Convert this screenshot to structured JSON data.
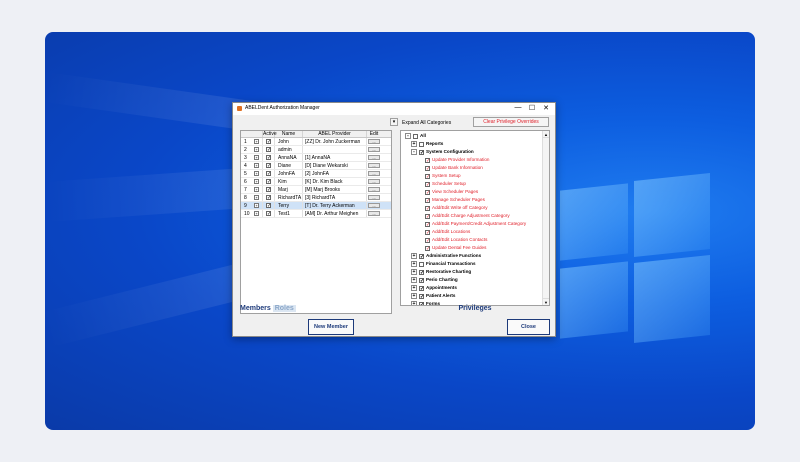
{
  "window": {
    "title": "ABELDent Authorization Manager",
    "controls": {
      "minimize": "—",
      "maximize": "☐",
      "close": "✕"
    }
  },
  "toolbar": {
    "dropdown_arrow": "▾",
    "expand_all_label": "Expand All Categories",
    "clear_overrides_label": "Clear Privilege Overrides"
  },
  "members": {
    "columns": [
      "",
      "Active",
      "Name",
      "ABEL Provider",
      "Edit"
    ],
    "rows": [
      {
        "num": "1",
        "active": "✓",
        "name": "John",
        "provider": "[ZZ] Dr. John Zuckerman",
        "selected": false
      },
      {
        "num": "2",
        "active": "✓",
        "name": "admin",
        "provider": "",
        "selected": false
      },
      {
        "num": "3",
        "active": "✓",
        "name": "AnnaNA",
        "provider": "[1] AnnaNA",
        "selected": false
      },
      {
        "num": "4",
        "active": "✓",
        "name": "Diane",
        "provider": "[D] Diane Wekarski",
        "selected": false
      },
      {
        "num": "5",
        "active": "✓",
        "name": "JohnFA",
        "provider": "[2] JohnFA",
        "selected": false
      },
      {
        "num": "6",
        "active": "✓",
        "name": "Kim",
        "provider": "[K] Dr. Kim Black",
        "selected": false
      },
      {
        "num": "7",
        "active": "✓",
        "name": "Marj",
        "provider": "[M] Marj Brooks",
        "selected": false
      },
      {
        "num": "8",
        "active": "✓",
        "name": "RichardTA",
        "provider": "[3] RichardTA",
        "selected": false
      },
      {
        "num": "9",
        "active": "✓",
        "name": "Terry",
        "provider": "[T] Dr. Terry Ackerman",
        "selected": true
      },
      {
        "num": "10",
        "active": "✓",
        "name": "Test1",
        "provider": "[AM] Dr. Arthur Meighen",
        "selected": false
      }
    ],
    "edit_button_label": "...",
    "tab_members": "Members",
    "tab_roles": "Roles"
  },
  "privileges": {
    "title": "Privileges",
    "nodes": [
      {
        "label": "All",
        "level": 0,
        "pm": "-",
        "checked": false,
        "style": "bold"
      },
      {
        "label": "Reports",
        "level": 1,
        "pm": "+",
        "checked": false,
        "style": "bold"
      },
      {
        "label": "System Configuration",
        "level": 1,
        "pm": "-",
        "checked": true,
        "style": "bold"
      },
      {
        "label": "Update Provider Information",
        "level": 2,
        "pm": "",
        "checked": true,
        "style": "red"
      },
      {
        "label": "Update Bank Information",
        "level": 2,
        "pm": "",
        "checked": true,
        "style": "red"
      },
      {
        "label": "System Setup",
        "level": 2,
        "pm": "",
        "checked": true,
        "style": "red"
      },
      {
        "label": "Scheduler Setup",
        "level": 2,
        "pm": "",
        "checked": true,
        "style": "red"
      },
      {
        "label": "View Scheduler Pages",
        "level": 2,
        "pm": "",
        "checked": true,
        "style": "red"
      },
      {
        "label": "Manage Scheduler Pages",
        "level": 2,
        "pm": "",
        "checked": true,
        "style": "red"
      },
      {
        "label": "Add/Edit Write off Category",
        "level": 2,
        "pm": "",
        "checked": true,
        "style": "red"
      },
      {
        "label": "Add/Edit Charge Adjustment Category",
        "level": 2,
        "pm": "",
        "checked": true,
        "style": "red"
      },
      {
        "label": "Add/Edit Payment/Credit Adjustment Category",
        "level": 2,
        "pm": "",
        "checked": true,
        "style": "red"
      },
      {
        "label": "Add/Edit Locations",
        "level": 2,
        "pm": "",
        "checked": true,
        "style": "red"
      },
      {
        "label": "Add/Edit Location Contacts",
        "level": 2,
        "pm": "",
        "checked": true,
        "style": "red"
      },
      {
        "label": "Update Dental Fee Guides",
        "level": 2,
        "pm": "",
        "checked": true,
        "style": "red"
      },
      {
        "label": "Administrative Functions",
        "level": 1,
        "pm": "+",
        "checked": true,
        "style": "bold"
      },
      {
        "label": "Financial Transactions",
        "level": 1,
        "pm": "+",
        "checked": false,
        "style": "bold"
      },
      {
        "label": "Restorative Charting",
        "level": 1,
        "pm": "+",
        "checked": true,
        "style": "bold"
      },
      {
        "label": "Perio Charting",
        "level": 1,
        "pm": "+",
        "checked": true,
        "style": "bold"
      },
      {
        "label": "Appointments",
        "level": 1,
        "pm": "+",
        "checked": true,
        "style": "bold"
      },
      {
        "label": "Patient Alerts",
        "level": 1,
        "pm": "+",
        "checked": true,
        "style": "bold"
      },
      {
        "label": "Forms",
        "level": 1,
        "pm": "+",
        "checked": true,
        "style": "bold"
      }
    ]
  },
  "buttons": {
    "new_member": "New Member",
    "close": "Close"
  },
  "scrollbar": {
    "up": "▲",
    "down": "▼"
  }
}
